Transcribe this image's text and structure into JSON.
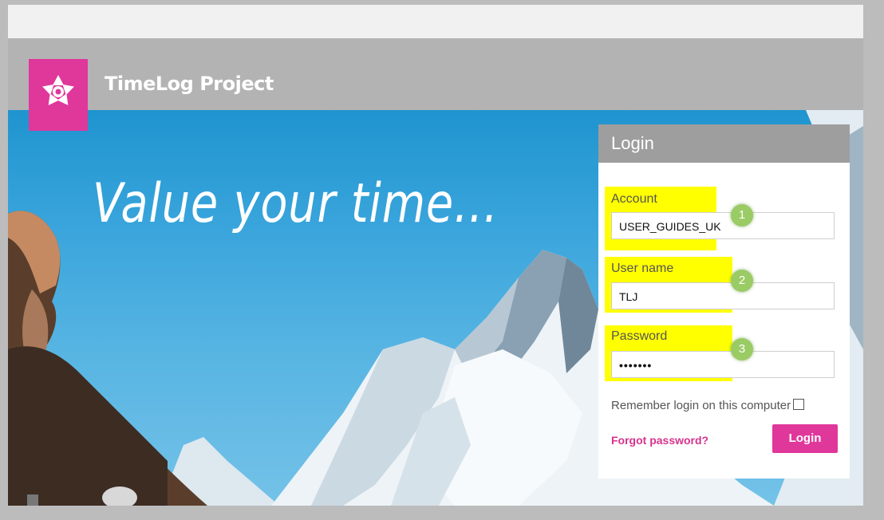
{
  "app": {
    "title": "TimeLog Project"
  },
  "hero": {
    "tagline": "Value your time..."
  },
  "login": {
    "heading": "Login",
    "account": {
      "label": "Account",
      "value": "USER_GUIDES_UK",
      "step": "1"
    },
    "username": {
      "label": "User name",
      "value": "TLJ",
      "step": "2"
    },
    "password": {
      "label": "Password",
      "value": "•••••••",
      "step": "3"
    },
    "remember_label": "Remember login on this computer",
    "forgot_label": "Forgot password?",
    "submit_label": "Login"
  },
  "colors": {
    "brand": "#e0379b",
    "header": "#b3b3b3",
    "highlight": "#ffff00",
    "step_badge": "#9acb64"
  }
}
